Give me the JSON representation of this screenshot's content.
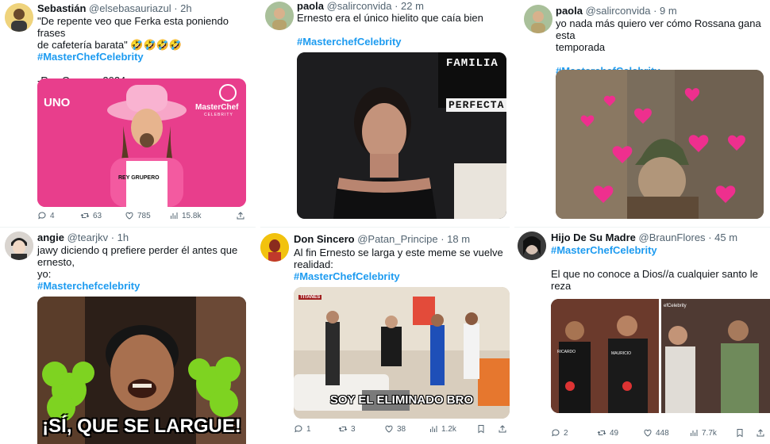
{
  "tweets": [
    {
      "name": "Sebastián",
      "handle": "@elsebasauriazul",
      "time": "· 2h",
      "line1": "\"De repente veo que Ferka esta poniendo frases",
      "line2": "de cafetería barata\" 🤣🤣🤣🤣",
      "hashtag": "#MasterChefCelebrity",
      "signature": "-Rey Grupero 2024",
      "image_labels": {
        "network": "UNO",
        "brand": "MasterChef",
        "brand_sub": "CELEBRITY",
        "apron": "REY GRUPERO"
      },
      "stats": {
        "replies": "4",
        "retweets": "63",
        "likes": "785",
        "views": "15.8k"
      }
    },
    {
      "name": "paola",
      "handle": "@salirconvida",
      "time": "· 22 m",
      "text": "Ernesto era el único hielito que caía bien",
      "hashtag": "#MasterchefCelebrity",
      "sign1": "FAMILIA",
      "sign2": "PERFECTA"
    },
    {
      "name": "paola",
      "handle": "@salirconvida",
      "time": "· 9 m",
      "line1": "yo nada más quiero ver cómo Rossana  gana esta",
      "line2": "temporada",
      "hashtag": "#MasterchefCelebrity"
    },
    {
      "name": "angie",
      "handle": "@tearjkv",
      "time": "· 1h",
      "line1": "jawy diciendo q prefiere perder él antes que",
      "line2": "ernesto,",
      "line3": "yo:",
      "hashtag": "#Masterchefcelebrity",
      "caption": "¡SÍ, QUE SE LARGUE!"
    },
    {
      "name": "Don Sincero",
      "handle": "@Patan_Principe",
      "time": "· 18 m",
      "line1": "Al fin Ernesto se larga y este meme se vuelve",
      "line2": "realidad:",
      "hashtag": "#MasterChefCelebrity",
      "tv_label": "TITANES",
      "caption": "SOY EL ELIMINADO BRO",
      "stats": {
        "replies": "1",
        "retweets": "3",
        "likes": "38",
        "views": "1.2k"
      }
    },
    {
      "name": "Hijo De Su Madre",
      "handle": "@BraunFlores",
      "time": "· 45 m",
      "hashtag": "#MasterChefCelebrity",
      "line1": "El que no conoce a Dios//a cualquier santo le",
      "line2": "reza",
      "apron1": "RICARDO",
      "apron2": "MAURICIO",
      "overlay": "efCelebrity",
      "stats": {
        "replies": "2",
        "retweets": "49",
        "likes": "448",
        "views": "7.7k"
      }
    }
  ],
  "colors": {
    "link": "#1d9bf0",
    "text": "#0f1419",
    "muted": "#536471",
    "pink": "#ee2f8e"
  },
  "icons": [
    "reply-icon",
    "retweet-icon",
    "like-icon",
    "views-icon",
    "bookmark-icon",
    "share-icon"
  ]
}
